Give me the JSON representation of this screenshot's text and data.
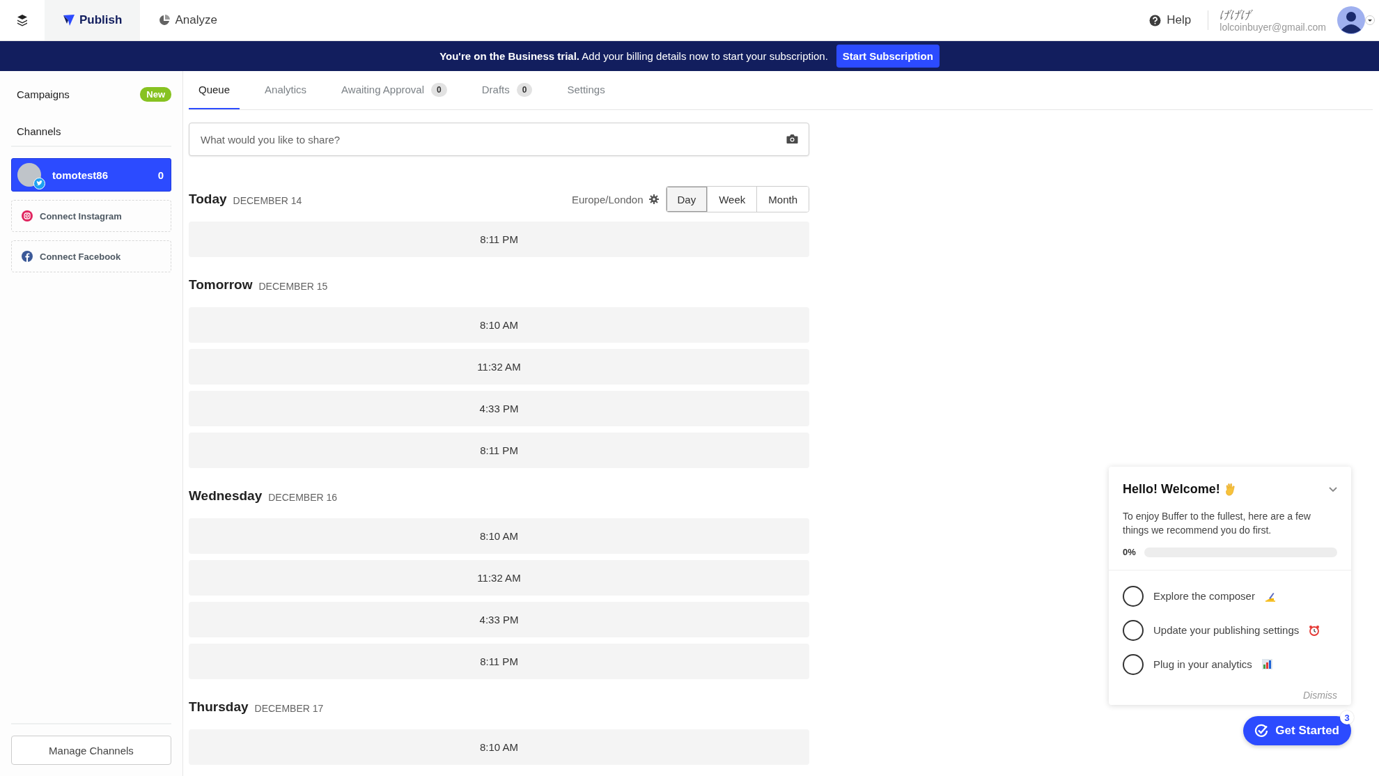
{
  "top_nav": {
    "items": [
      {
        "label": "Publish",
        "kind": "publish",
        "selected": true
      },
      {
        "label": "Analyze",
        "kind": "analyze",
        "selected": false
      }
    ],
    "help": "Help",
    "user": {
      "name": "げげげ",
      "email": "lolcoinbuyer@gmail.com"
    }
  },
  "banner": {
    "text": "**You're on the Business trial.** Add your billing details now to start your subscription.",
    "button": "Start Subscription"
  },
  "sidebar": {
    "campaigns": "Campaigns",
    "campaigns_badge": "New",
    "channels_heading": "Channels",
    "channels": [
      {
        "name": "tomotest86",
        "count": "0",
        "selected": true
      }
    ],
    "connect": [
      {
        "kind": "instagram",
        "label": "Connect Instagram"
      },
      {
        "kind": "facebook",
        "label": "Connect Facebook"
      }
    ],
    "manage_button": "Manage Channels"
  },
  "tabs": [
    {
      "label": "Queue",
      "selected": true
    },
    {
      "label": "Analytics",
      "selected": false
    },
    {
      "label": "Awaiting Approval",
      "count": "0",
      "selected": false
    },
    {
      "label": "Drafts",
      "count": "0",
      "selected": false
    },
    {
      "label": "Settings",
      "selected": false
    }
  ],
  "composer": {
    "placeholder": "What would you like to share?"
  },
  "timezone": "Europe/London",
  "view_options": [
    {
      "label": "Day",
      "selected": true
    },
    {
      "label": "Week",
      "selected": false
    },
    {
      "label": "Month",
      "selected": false
    }
  ],
  "days": [
    {
      "name": "Today",
      "date": "DECEMBER 14",
      "slots": [
        "8:11 PM"
      ]
    },
    {
      "name": "Tomorrow",
      "date": "DECEMBER 15",
      "slots": [
        "8:10 AM",
        "11:32 AM",
        "4:33 PM",
        "8:11 PM"
      ]
    },
    {
      "name": "Wednesday",
      "date": "DECEMBER 16",
      "slots": [
        "8:10 AM",
        "11:32 AM",
        "4:33 PM",
        "8:11 PM"
      ]
    },
    {
      "name": "Thursday",
      "date": "DECEMBER 17",
      "slots": [
        "8:10 AM"
      ]
    }
  ],
  "welcome": {
    "title": "Hello! Welcome!",
    "text": "To enjoy Buffer to the fullest, here are a few things we recommend you do first.",
    "progress_label": "0%",
    "level": 0,
    "tasks": [
      {
        "kind": "composer",
        "label": "Explore the composer",
        "checked": false
      },
      {
        "kind": "settings",
        "label": "Update your publishing settings",
        "checked": false
      },
      {
        "kind": "analytics",
        "label": "Plug in your analytics",
        "checked": false
      }
    ],
    "dismiss": "Dismiss"
  },
  "get_started": {
    "label": "Get Started",
    "badge": "3"
  }
}
